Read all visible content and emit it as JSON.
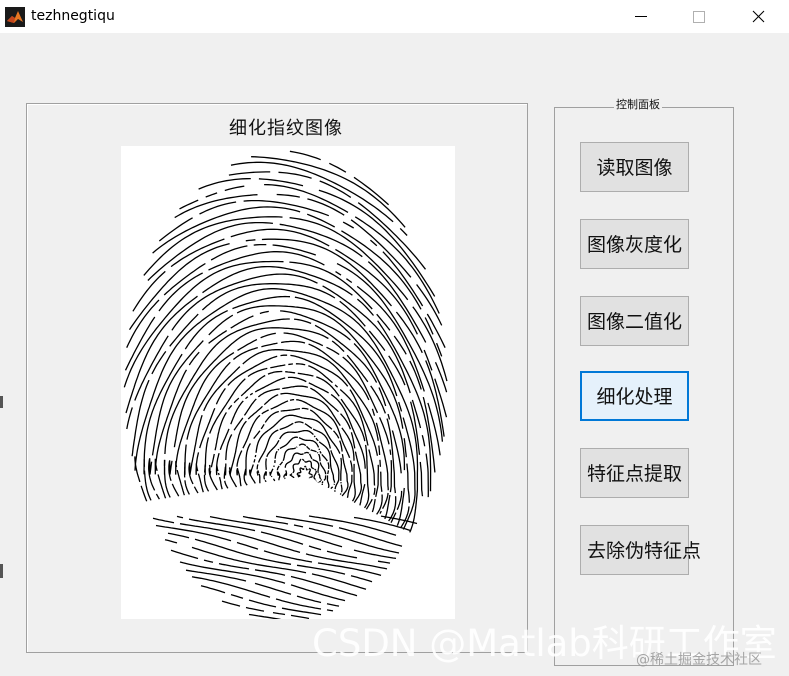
{
  "window": {
    "title": "tezhnegtiqu",
    "icon": "matlab-icon",
    "controls": [
      "minimize-icon",
      "maximize-icon",
      "close-icon"
    ]
  },
  "figure": {
    "title": "细化指纹图像",
    "image": "thinned-fingerprint"
  },
  "control_panel": {
    "title": "控制面板",
    "buttons": [
      {
        "label": "读取图像"
      },
      {
        "label": "图像灰度化"
      },
      {
        "label": "图像二值化"
      },
      {
        "label": "细化处理",
        "focused": true
      },
      {
        "label": "特征点提取"
      },
      {
        "label": "去除伪特征点"
      }
    ]
  },
  "watermarks": {
    "csdn": "CSDN @Matlab科研工作室",
    "juejin": "@稀土掘金技术社区"
  },
  "colors": {
    "focus_border": "#0078d7",
    "button_face": "#e1e1e1",
    "background": "#f0f0f0"
  }
}
